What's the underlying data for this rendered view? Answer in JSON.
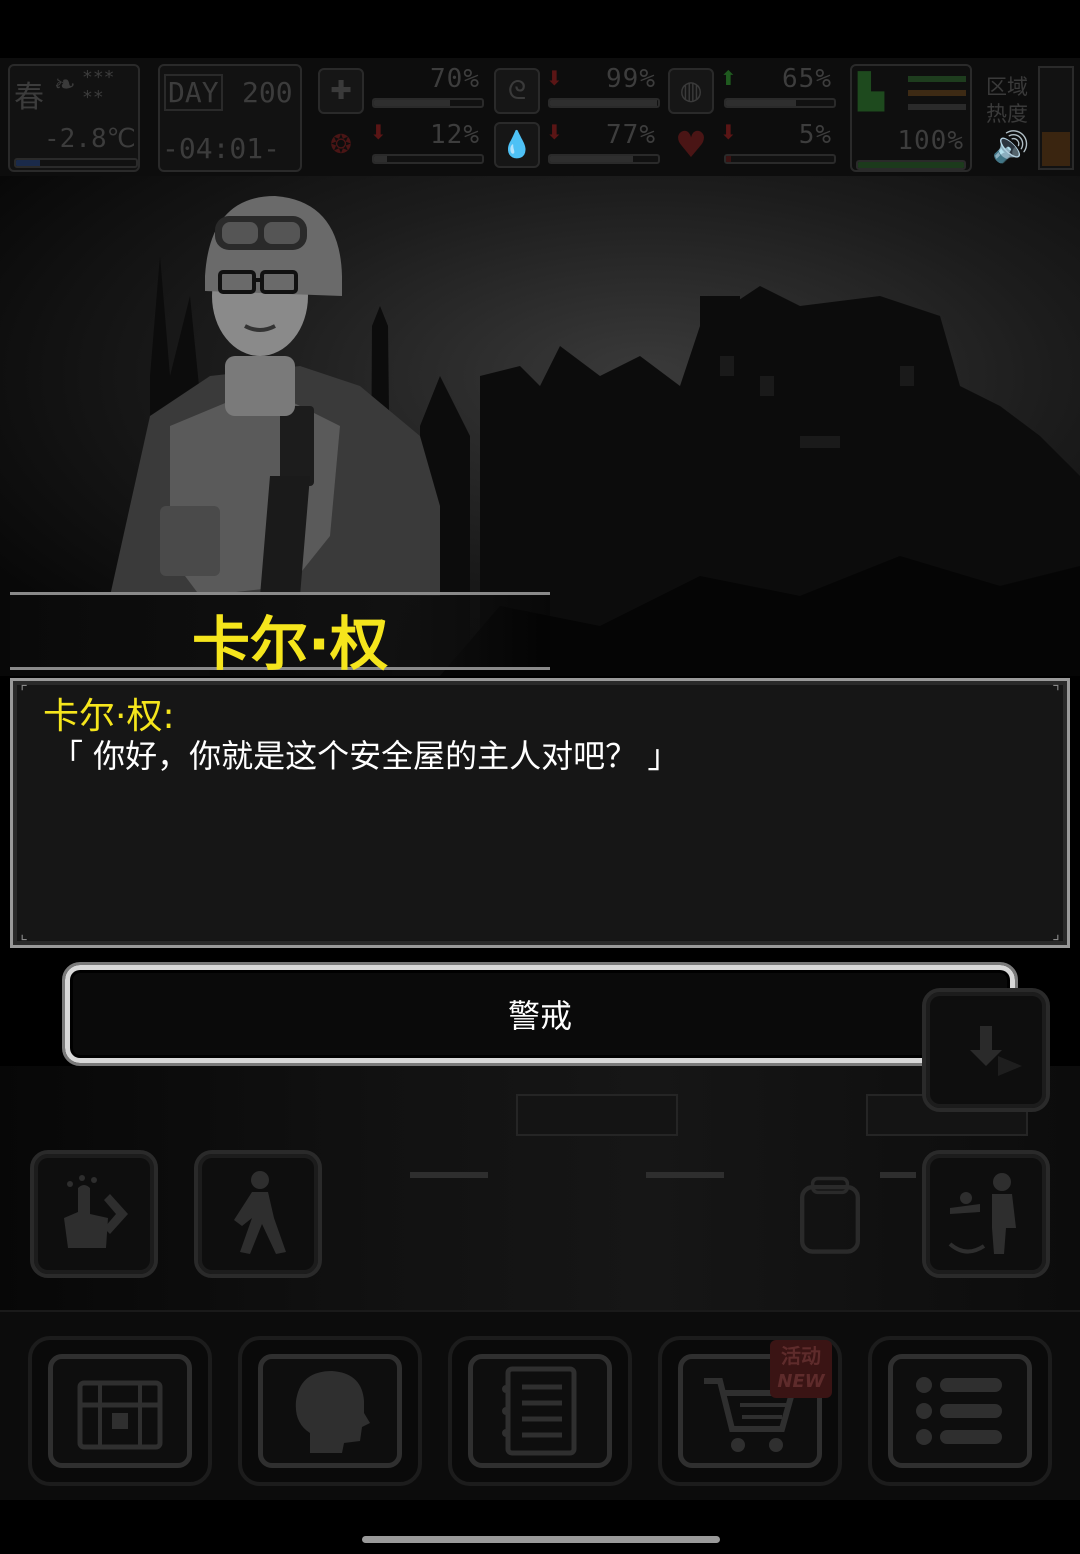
{
  "status": {
    "season": "春",
    "weather": "***\n**",
    "temperature": "-2.8℃",
    "day_label": "DAY",
    "day_number": "200",
    "clock": "-04:01-",
    "health": {
      "value": "70%",
      "level": 0.7
    },
    "hunger": {
      "value": "99%",
      "level": 0.99
    },
    "fatigue": {
      "value": "65%",
      "level": 0.65
    },
    "stamina": {
      "value": "100%",
      "level": 1.0
    },
    "infection": {
      "value": "12%",
      "level": 0.12
    },
    "thirst": {
      "value": "77%",
      "level": 0.77
    },
    "heart": {
      "value": "5%",
      "level": 0.05
    },
    "zone_label": "区域\n热度",
    "zone_heat_level": 0.55
  },
  "npc": {
    "name": "卡尔·权"
  },
  "dialog": {
    "speaker": "卡尔·权:",
    "text": "「 你好，你就是这个安全屋的主人对吧？ 」"
  },
  "option": {
    "label": "警戒"
  },
  "menu": {
    "badge_top": "活动",
    "badge_bottom": "NEW"
  },
  "colors": {
    "accent_yellow": "#f5e51c",
    "dialog_border": "#9a9a9a",
    "background": "#000000"
  },
  "icons": [
    "medkit-icon",
    "stomach-icon",
    "helmet-icon",
    "boot-icon",
    "brain-icon",
    "water-drop-icon",
    "heart-icon",
    "speaker-icon",
    "tap-arrow-icon",
    "walk-icon",
    "fight-icon",
    "chest-icon",
    "mind-icon",
    "journal-icon",
    "cart-icon",
    "menu-list-icon"
  ]
}
